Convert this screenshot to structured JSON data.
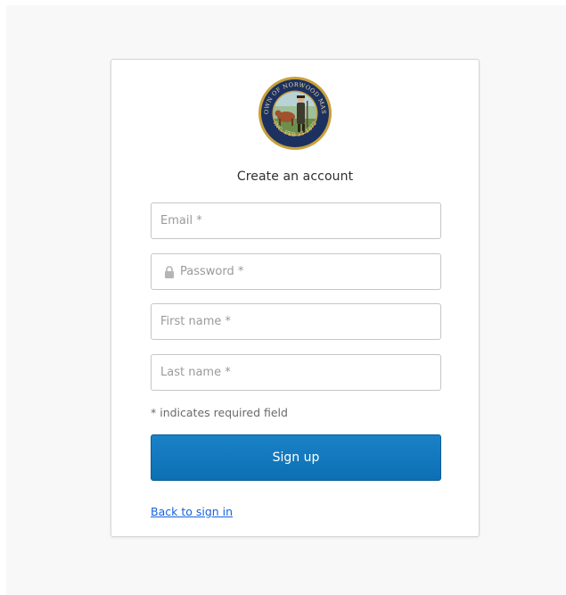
{
  "heading": "Create an account",
  "form": {
    "email_placeholder": "Email *",
    "password_placeholder": "Password *",
    "first_name_placeholder": "First name *",
    "last_name_placeholder": "Last name *",
    "required_hint": "* indicates required field",
    "signup_label": "Sign up",
    "back_link": "Back to sign in"
  },
  "logo": {
    "top_text": "TOWN OF NORWOOD MASS",
    "bottom_text": "INC. FEB 23 1872"
  },
  "colors": {
    "primary": "#0d6fb3",
    "link": "#1662dd",
    "logo_gold": "#c9a13c",
    "logo_navy": "#1c3160"
  },
  "icons": {
    "password": "lock-icon"
  }
}
